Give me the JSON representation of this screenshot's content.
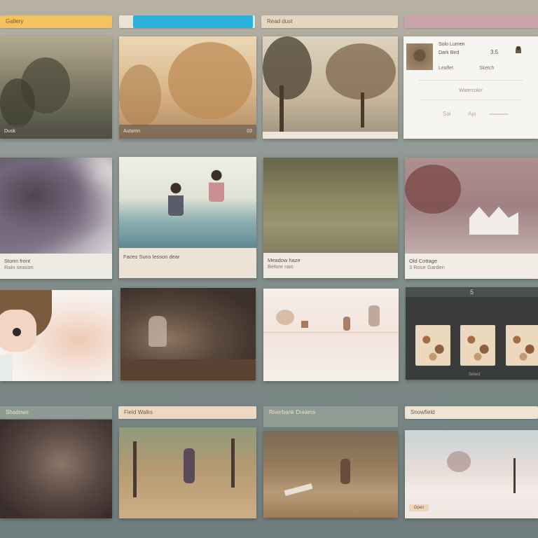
{
  "tabs": {
    "t1": "Gallery",
    "t2": "",
    "t3": "Read dust",
    "t4": ""
  },
  "tiles": {
    "r1c1": {
      "left": "Dusk",
      "right": ""
    },
    "r1c2": {
      "left": "Autumn",
      "right": "03"
    },
    "r2c2": {
      "line1": "Faces Suns lesson dear",
      "line2": ""
    },
    "r2c3": {
      "line1": "Meadow haze",
      "line2": "Before rain"
    },
    "r2c4": {
      "line1": "Old Cottage",
      "line2": "3 Rose Garden"
    }
  },
  "profile": {
    "name": "Solo Lumen",
    "subtitle": "Dark Bird",
    "score": "3.5",
    "meta_left": "Leaflet",
    "meta_right": "Sketch",
    "center_label": "Watercolor",
    "footer_left": "Sal",
    "footer_mid": "Aja"
  },
  "dark_panel": {
    "top": "5",
    "footer": "Select"
  },
  "row4": {
    "c1": "Shadows",
    "c2": "Field Walks",
    "c3": "Riverbank Dreams",
    "c4": "Snowfield",
    "c4_badge": "Open"
  },
  "colors": {
    "tab_yellow": "#f4c35f",
    "tab_cyan": "#2bb2dc",
    "tab_beige": "#e5d6bf",
    "tab_rose": "#c9a3ab"
  }
}
